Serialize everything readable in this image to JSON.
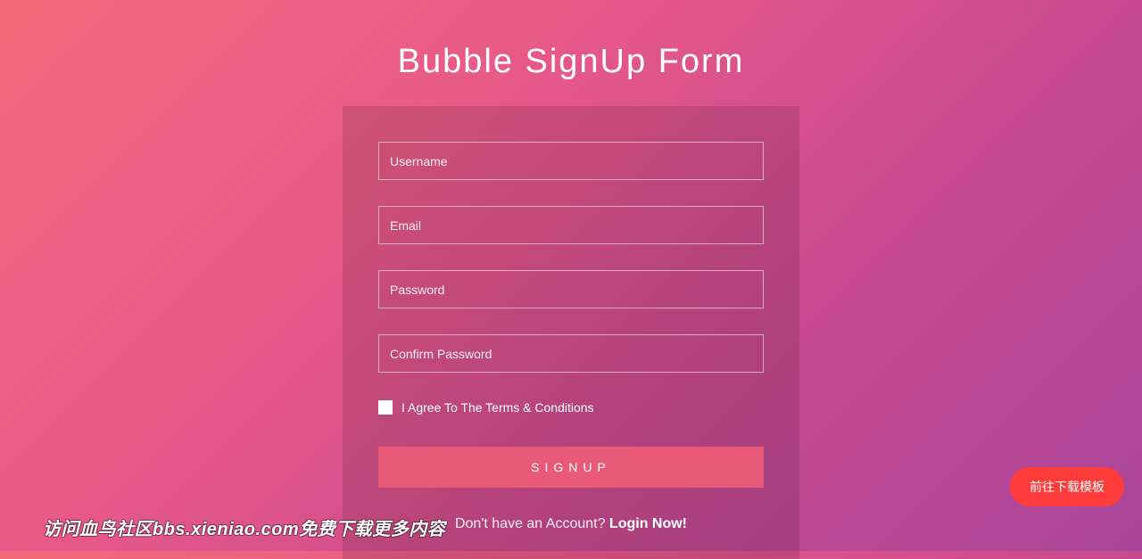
{
  "title": "Bubble SignUp Form",
  "form": {
    "fields": {
      "username": {
        "placeholder": "Username",
        "value": ""
      },
      "email": {
        "placeholder": "Email",
        "value": ""
      },
      "password": {
        "placeholder": "Password",
        "value": ""
      },
      "confirm": {
        "placeholder": "Confirm Password",
        "value": ""
      }
    },
    "terms_label": "I Agree To The Terms & Conditions",
    "submit_label": "SIGNUP"
  },
  "prompt": {
    "text": "Don't have an Account? ",
    "link": "Login Now!"
  },
  "download_btn": "前往下载模板",
  "watermark": "访问血鸟社区bbs.xieniao.com免费下载更多内容"
}
